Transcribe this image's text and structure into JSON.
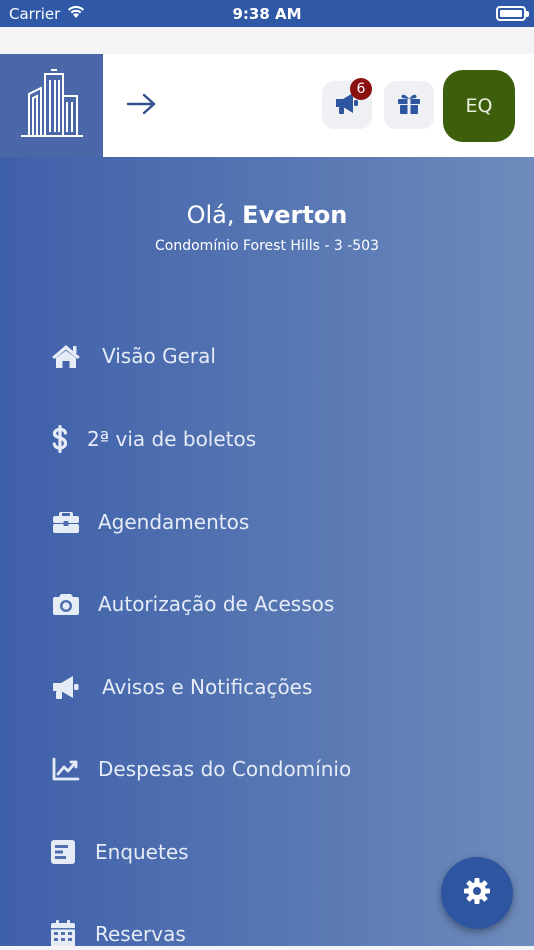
{
  "status_bar": {
    "carrier": "Carrier",
    "time": "9:38 AM"
  },
  "header": {
    "notification_count": "6",
    "avatar_initials": "EQ",
    "colors": {
      "header_bg": "#ffffff",
      "logo_bg": "#4a68a8",
      "avatar_bg": "#3d5f0c",
      "badge_bg": "#8b1010"
    }
  },
  "drawer": {
    "greeting_prefix": "Olá,",
    "user_name": "Everton",
    "subtitle": "Condomínio Forest Hills - 3 -503",
    "items": [
      {
        "label": "Visão Geral",
        "icon": "home-icon"
      },
      {
        "label": "2ª via de boletos",
        "icon": "dollar-icon"
      },
      {
        "label": "Agendamentos",
        "icon": "briefcase-icon"
      },
      {
        "label": "Autorização de Acessos",
        "icon": "camera-icon"
      },
      {
        "label": "Avisos e Notificações",
        "icon": "megaphone-icon"
      },
      {
        "label": "Despesas do Condomínio",
        "icon": "chart-line-icon"
      },
      {
        "label": "Enquetes",
        "icon": "poll-icon"
      },
      {
        "label": "Reservas",
        "icon": "calendar-icon"
      }
    ],
    "colors": {
      "gradient_start": "#3f60aa",
      "gradient_end": "#6f8bbb",
      "fab": "#2e56a0"
    }
  }
}
